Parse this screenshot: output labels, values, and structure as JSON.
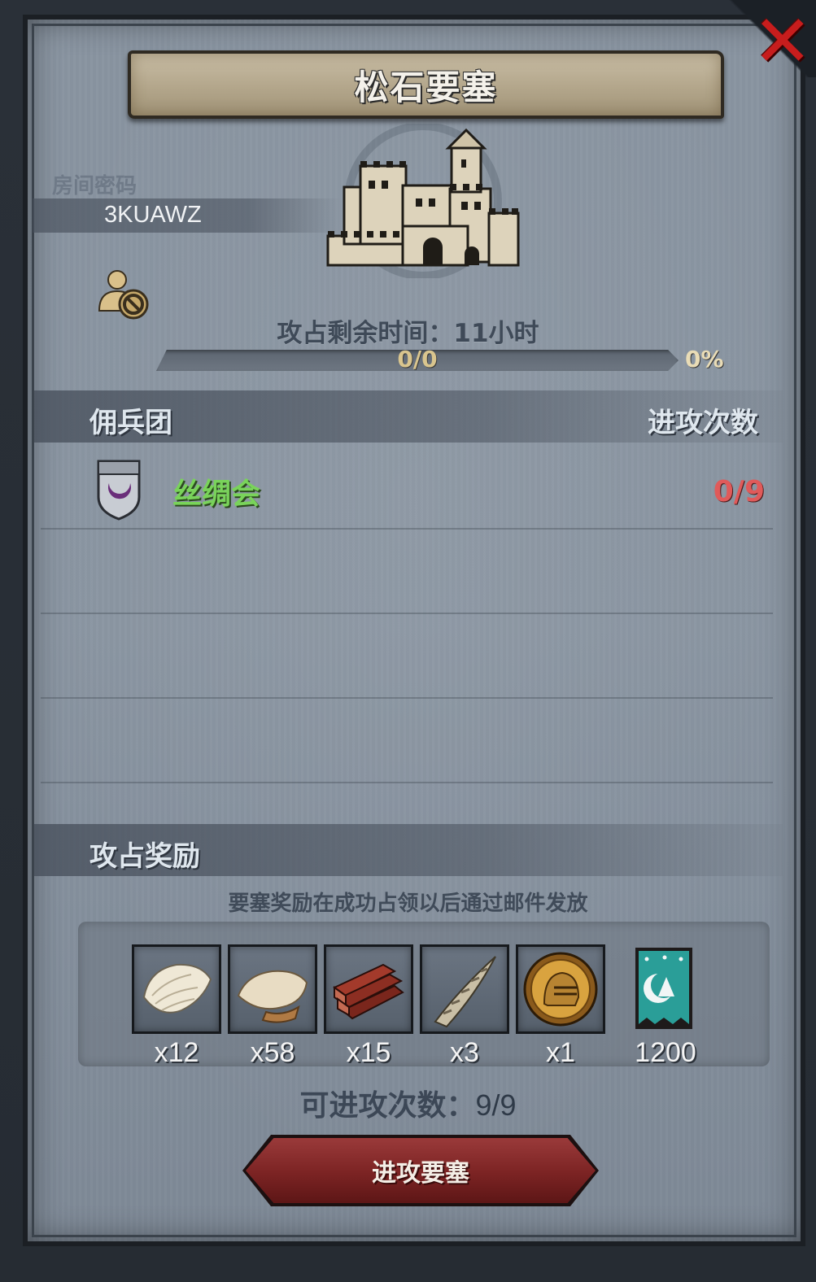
{
  "title": "松石要塞",
  "room": {
    "label": "房间密码",
    "code": "3KUAWZ"
  },
  "capture": {
    "time_label": "攻占剩余时间：",
    "time_value": "11小时",
    "progress_text": "0/0",
    "progress_percent_text": "0%",
    "progress_fraction": 0
  },
  "mercenary": {
    "header": "佣兵团",
    "attacks_header": "进攻次数",
    "guilds": [
      {
        "name": "丝绸会",
        "attacks": "0/9"
      }
    ]
  },
  "rewards": {
    "header": "攻占奖励",
    "note": "要塞奖励在成功占领以后通过邮件发放",
    "items": [
      {
        "icon": "silk-cloth-icon",
        "qty": "x12"
      },
      {
        "icon": "fur-hide-icon",
        "qty": "x58"
      },
      {
        "icon": "timber-planks-icon",
        "qty": "x15"
      },
      {
        "icon": "twisted-horn-icon",
        "qty": "x3"
      },
      {
        "icon": "knight-helmet-medal-icon",
        "qty": "x1"
      },
      {
        "icon": "guild-banner-icon",
        "qty": "1200"
      }
    ]
  },
  "attacks_available": {
    "label": "可进攻次数：",
    "value": "9/9"
  },
  "attack_button": {
    "label": "进攻要塞"
  },
  "colors": {
    "panel": "#8a95a2",
    "guild_name": "#79d35a",
    "attack_count": "#e05a5a",
    "button": "#7b2323",
    "close": "#c71d1d"
  }
}
